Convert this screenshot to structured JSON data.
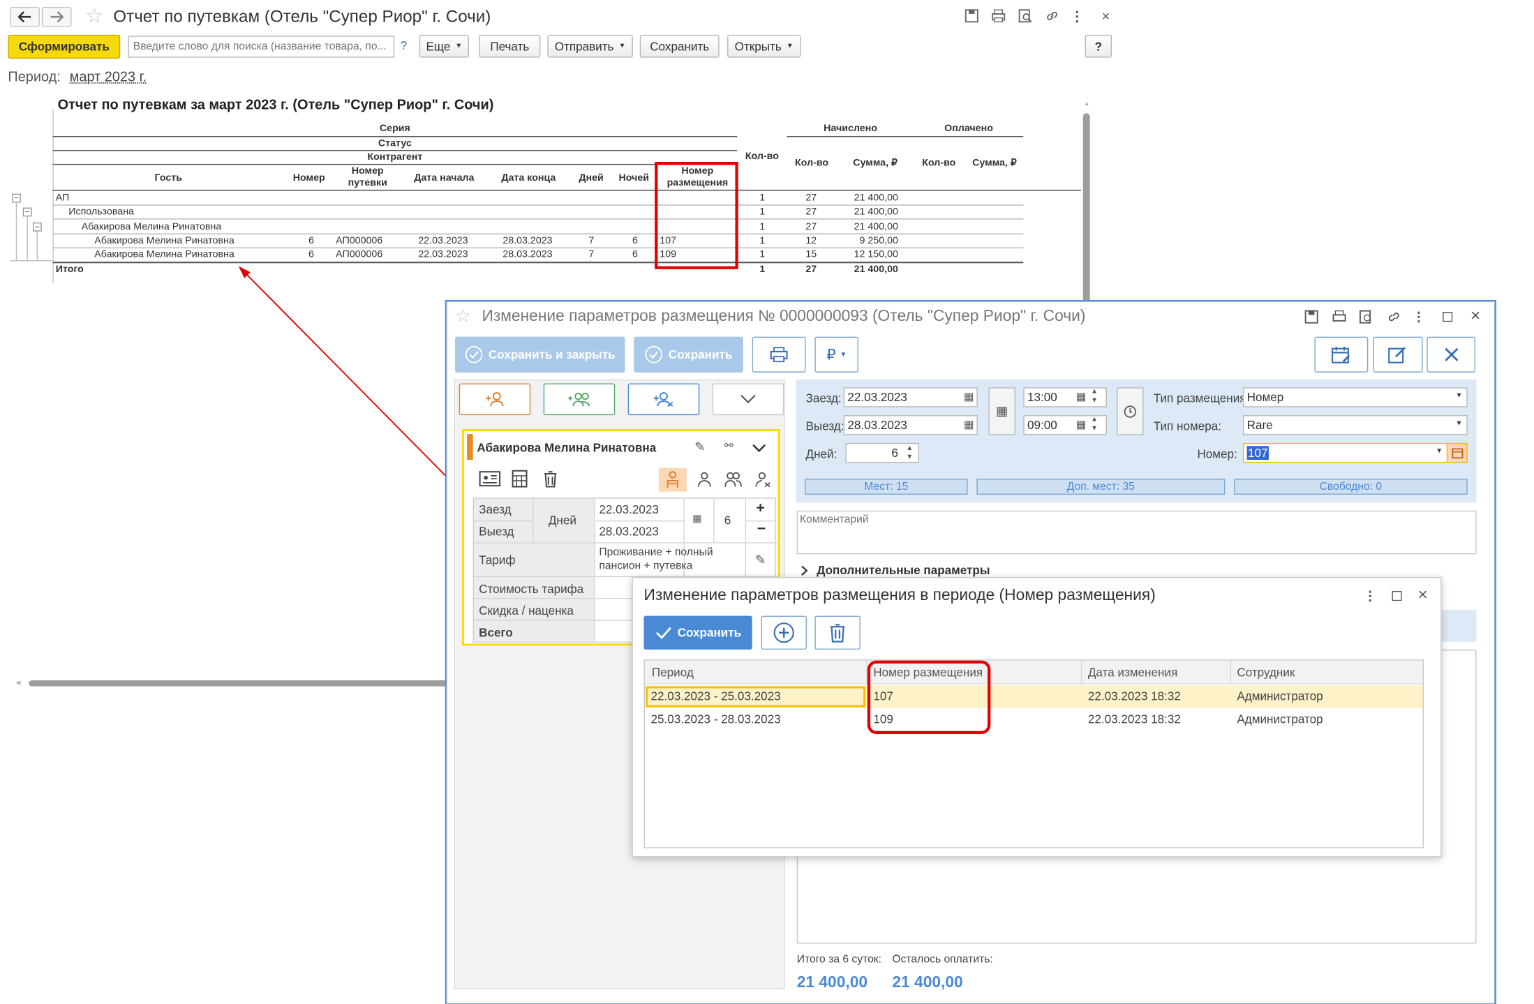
{
  "main_window": {
    "title": "Отчет по путевкам (Отель \"Супер Риор\" г. Сочи)",
    "toolbar": {
      "generate": "Сформировать",
      "search_placeholder": "Введите слово для поиска (название товара, по...",
      "help_mark": "?",
      "more": "Еще",
      "print": "Печать",
      "send": "Отправить",
      "save": "Сохранить",
      "open": "Открыть",
      "help": "?"
    },
    "period_label": "Период:",
    "period_value": "март 2023 г."
  },
  "report": {
    "title": "Отчет по путевкам за март 2023 г. (Отель \"Супер Риор\" г. Сочи)",
    "group_headers": {
      "series": "Серия",
      "status": "Статус",
      "counterparty": "Контрагент"
    },
    "headers": {
      "guest": "Гость",
      "number": "Номер",
      "voucher_number_1": "Номер",
      "voucher_number_2": "путевки",
      "start_date": "Дата начала",
      "end_date": "Дата конца",
      "days": "Дней",
      "nights": "Ночей",
      "room_number_1": "Номер",
      "room_number_2": "размещения",
      "qty": "Кол-во",
      "accrued": "Начислено",
      "paid": "Оплачено",
      "accrued_qty": "Кол-во",
      "accrued_sum": "Сумма, ₽",
      "paid_qty": "Кол-во",
      "paid_sum": "Сумма, ₽"
    },
    "rows": [
      {
        "guest": "АП",
        "number": "",
        "voucher": "",
        "start": "",
        "end": "",
        "days": "",
        "nights": "",
        "room": "",
        "qty": "1",
        "acc_qty": "27",
        "acc_sum": "21 400,00"
      },
      {
        "guest": "Использована",
        "number": "",
        "voucher": "",
        "start": "",
        "end": "",
        "days": "",
        "nights": "",
        "room": "",
        "qty": "1",
        "acc_qty": "27",
        "acc_sum": "21 400,00"
      },
      {
        "guest": "Абакирова Мелина Ринатовна",
        "number": "",
        "voucher": "",
        "start": "",
        "end": "",
        "days": "",
        "nights": "",
        "room": "",
        "qty": "1",
        "acc_qty": "27",
        "acc_sum": "21 400,00"
      },
      {
        "guest": "Абакирова Мелина Ринатовна",
        "number": "6",
        "voucher": "АП000006",
        "start": "22.03.2023",
        "end": "28.03.2023",
        "days": "7",
        "nights": "6",
        "room": "107",
        "qty": "1",
        "acc_qty": "12",
        "acc_sum": "9 250,00"
      },
      {
        "guest": "Абакирова Мелина Ринатовна",
        "number": "6",
        "voucher": "АП000006",
        "start": "22.03.2023",
        "end": "28.03.2023",
        "days": "7",
        "nights": "6",
        "room": "109",
        "qty": "1",
        "acc_qty": "15",
        "acc_sum": "12 150,00"
      }
    ],
    "total": {
      "label": "Итого",
      "qty": "1",
      "acc_qty": "27",
      "acc_sum": "21 400,00"
    }
  },
  "placement_window": {
    "title": "Изменение параметров размещения  № 0000000093 (Отель \"Супер Риор\" г. Сочи)",
    "save_close": "Сохранить и закрыть",
    "save": "Сохранить",
    "currency": "₽",
    "guest_name": "Абакирова Мелина Ринатовна",
    "guest_grid": {
      "checkin_label": "Заезд",
      "checkout_label": "Выезд",
      "days_label": "Дней",
      "checkin_date": "22.03.2023",
      "checkout_date": "28.03.2023",
      "days": "6",
      "tariff_label": "Тариф",
      "tariff_value": "Проживание + полный пансион + путевка",
      "tariff_cost_label": "Стоимость тарифа",
      "discount_label": "Скидка / наценка",
      "total_label": "Всего"
    },
    "form": {
      "checkin_label": "Заезд:",
      "checkin_date": "22.03.2023",
      "checkin_time": "13:00",
      "checkout_label": "Выезд:",
      "checkout_date": "28.03.2023",
      "checkout_time": "09:00",
      "days_label": "Дней:",
      "days": "6",
      "placement_type_label": "Тип размещения:",
      "placement_type": "Номер",
      "room_type_label": "Тип номера:",
      "room_type": "Rare",
      "room_label": "Номер:",
      "room": "107",
      "places": "Мест: 15",
      "extra_places": "Доп. мест: 35",
      "free": "Свободно: 0",
      "comment_placeholder": "Комментарий",
      "extra_params": "Дополнительные параметры"
    },
    "totals": {
      "label_total": "Итого за 6 суток:",
      "label_left": "Осталось оплатить:",
      "total": "21 400,00",
      "left": "21 400,00"
    }
  },
  "period_dialog": {
    "title": "Изменение параметров размещения в периоде (Номер размещения)",
    "save": "Сохранить",
    "columns": [
      "Период",
      "Номер размещения",
      "Дата изменения",
      "Сотрудник"
    ],
    "rows": [
      {
        "period": "22.03.2023 - 25.03.2023",
        "room": "107",
        "changed": "22.03.2023 18:32",
        "employee": "Администратор"
      },
      {
        "period": "25.03.2023 - 28.03.2023",
        "room": "109",
        "changed": "22.03.2023 18:32",
        "employee": "Администратор"
      }
    ]
  },
  "colors": {
    "accent_yellow": "#f5d90a",
    "blue_button": "#4a8ad4",
    "highlight_red": "#e00000",
    "selected_row": "#fdf2c8",
    "total_blue": "#4a8ad4"
  }
}
